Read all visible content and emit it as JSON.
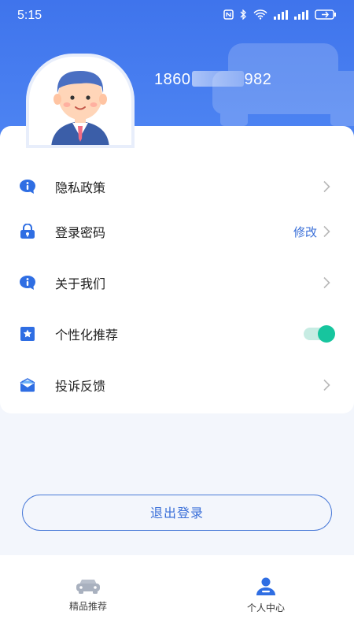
{
  "status_bar": {
    "time": "5:15"
  },
  "profile": {
    "phone_prefix": "1860",
    "phone_suffix": "982"
  },
  "menu": [
    {
      "label": "隐私政策",
      "icon": "info-bubble-icon",
      "extra": ""
    },
    {
      "label": "登录密码",
      "icon": "lock-icon",
      "extra": "修改"
    },
    {
      "label": "关于我们",
      "icon": "info-bubble-icon",
      "extra": ""
    },
    {
      "label": "个性化推荐",
      "icon": "bookmark-star-icon",
      "toggle_on": true
    },
    {
      "label": "投诉反馈",
      "icon": "mail-icon",
      "extra": ""
    }
  ],
  "logout_label": "退出登录",
  "tabbar": [
    {
      "label": "精品推荐",
      "icon": "car-icon",
      "active": false
    },
    {
      "label": "个人中心",
      "icon": "person-icon",
      "active": true
    }
  ],
  "colors": {
    "primary": "#3f74ec",
    "toggle": "#17c59e",
    "link": "#3a6fd8"
  }
}
